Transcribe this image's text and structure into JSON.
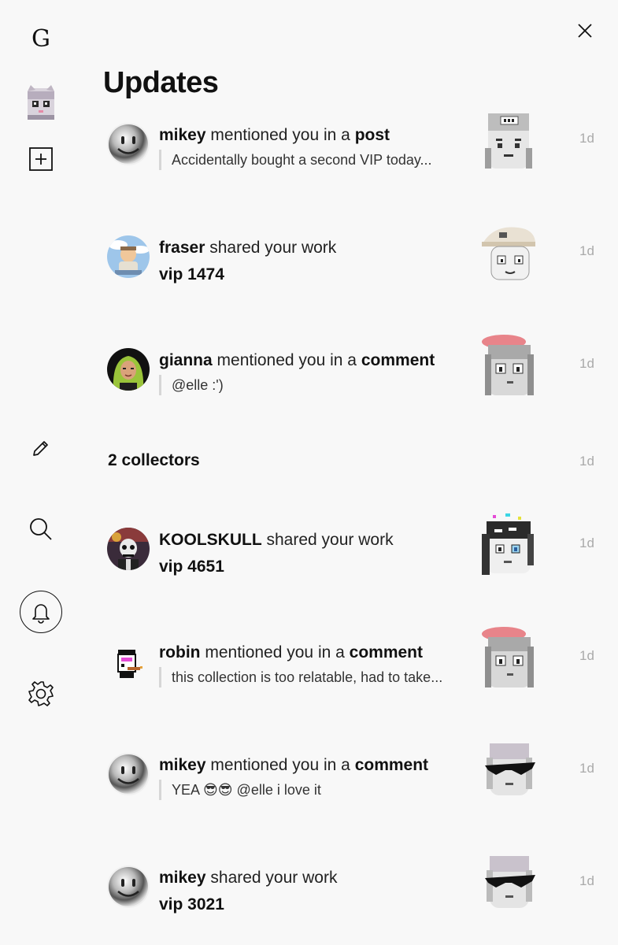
{
  "sidebar": {
    "logo": "G",
    "icons": [
      "avatar",
      "plus-square-icon",
      "pencil-icon",
      "search-icon",
      "bell-icon",
      "gear-icon"
    ]
  },
  "page": {
    "title": "Updates"
  },
  "colors": {
    "background": "#f8f8f8",
    "text": "#111111",
    "timestamp": "#aaaaaa",
    "quote_bar": "#d6d6d6"
  },
  "notifications": [
    {
      "user": "mikey",
      "action": "mentioned you in a",
      "target": "post",
      "quote": "Accidentally bought a second VIP today...",
      "time": "1d"
    },
    {
      "user": "fraser",
      "action": "shared your work",
      "sub": "vip 1474",
      "time": "1d"
    },
    {
      "user": "gianna",
      "action": "mentioned you in a",
      "target": "comment",
      "quote": "@elle :')",
      "time": "1d"
    },
    {
      "user": "KOOLSKULL",
      "action": "shared your work",
      "sub": "vip 4651",
      "time": "1d"
    },
    {
      "user": "robin",
      "action": "mentioned you in a",
      "target": "comment",
      "quote": "this collection is too relatable, had to take...",
      "time": "1d"
    },
    {
      "user": "mikey",
      "action": "mentioned you in a",
      "target": "comment",
      "quote": "YEA 😎😎 @elle i love it",
      "time": "1d"
    },
    {
      "user": "mikey",
      "action": "shared your work",
      "sub": "vip 3021",
      "time": "1d"
    }
  ],
  "collectors": {
    "label": "2 collectors",
    "time": "1d"
  }
}
